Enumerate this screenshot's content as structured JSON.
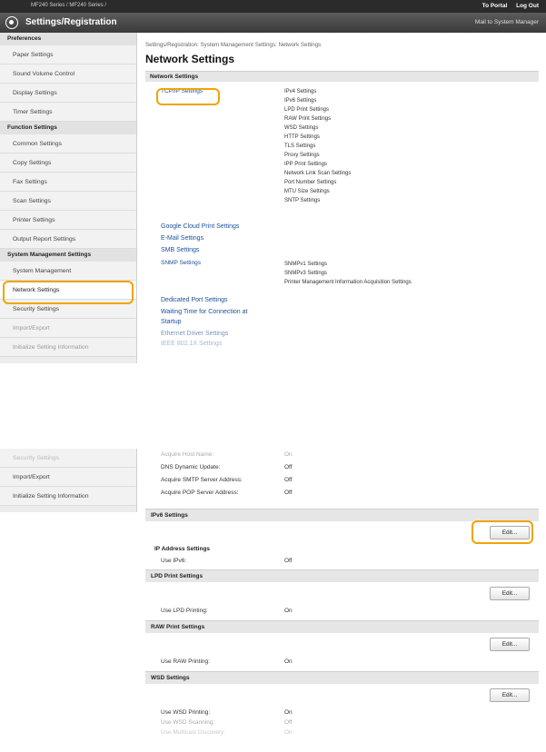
{
  "header": {
    "breadcrumb": "MF240 Series / MF240 Series /",
    "to_portal": "To Portal",
    "log_out": "Log Out",
    "title": "Settings/Registration",
    "mail": "Mail to System Manager"
  },
  "sidebar": {
    "groups": [
      {
        "label": "Preferences",
        "items": [
          "Paper Settings",
          "Sound Volume Control",
          "Display Settings",
          "Timer Settings"
        ]
      },
      {
        "label": "Function Settings",
        "items": [
          "Common Settings",
          "Copy Settings",
          "Fax Settings",
          "Scan Settings",
          "Printer Settings",
          "Output Report Settings"
        ]
      },
      {
        "label": "System Management Settings",
        "items": [
          "System Management",
          "Network Settings",
          "Security Settings",
          "Import/Export",
          "Initialize Setting Information"
        ]
      }
    ]
  },
  "main": {
    "breadcrumb": "Settings/Registration: System Management Settings: Network Settings",
    "title": "Network Settings",
    "section": "Network Settings",
    "tcpip": {
      "label": "TCP/IP Settings",
      "subs": [
        "IPv4 Settings",
        "IPv6 Settings",
        "LPD Print Settings",
        "RAW Print Settings",
        "WSD Settings",
        "HTTP Settings",
        "TLS Settings",
        "Proxy Settings",
        "IPP Print Settings",
        "Network Link Scan Settings",
        "Port Number Settings",
        "MTU Size Settings",
        "SNTP Settings"
      ]
    },
    "links": [
      "Google Cloud Print Settings",
      "E-Mail Settings",
      "SMB Settings"
    ],
    "snmp": {
      "label": "SNMP Settings",
      "subs": [
        "SNMPv1 Settings",
        "SNMPv3 Settings",
        "Printer Management Information Acquisition Settings"
      ]
    },
    "links2": [
      "Dedicated Port Settings",
      "Waiting Time for Connection at",
      "Startup",
      "Ethernet Driver Settings",
      "IEEE 802.1X Settings"
    ]
  },
  "shot2": {
    "sidebar_items": [
      "Security Settings",
      "Import/Export",
      "Initialize Setting Information"
    ],
    "top_rows": [
      {
        "k": "Acquire Host Name:",
        "v": "On"
      },
      {
        "k": "DNS Dynamic Update:",
        "v": "Off"
      },
      {
        "k": "Acquire SMTP Server Address:",
        "v": "Off"
      },
      {
        "k": "Acquire POP Server Address:",
        "v": "Off"
      }
    ],
    "ipv6": {
      "title": "IPv6 Settings",
      "edit": "Edit...",
      "subhead": "IP Address Settings",
      "k": "Use IPv6:",
      "v": "Off"
    },
    "lpd": {
      "title": "LPD Print Settings",
      "edit": "Edit...",
      "k": "Use LPD Printing:",
      "v": "On"
    },
    "raw": {
      "title": "RAW Print Settings",
      "edit": "Edit...",
      "k": "Use RAW Printing:",
      "v": "On"
    },
    "wsd": {
      "title": "WSD Settings",
      "edit": "Edit...",
      "rows": [
        {
          "k": "Use WSD Printing:",
          "v": "On"
        },
        {
          "k": "Use WSD Scanning:",
          "v": "Off"
        },
        {
          "k": "Use Multicast Discovery:",
          "v": "On"
        }
      ]
    }
  }
}
